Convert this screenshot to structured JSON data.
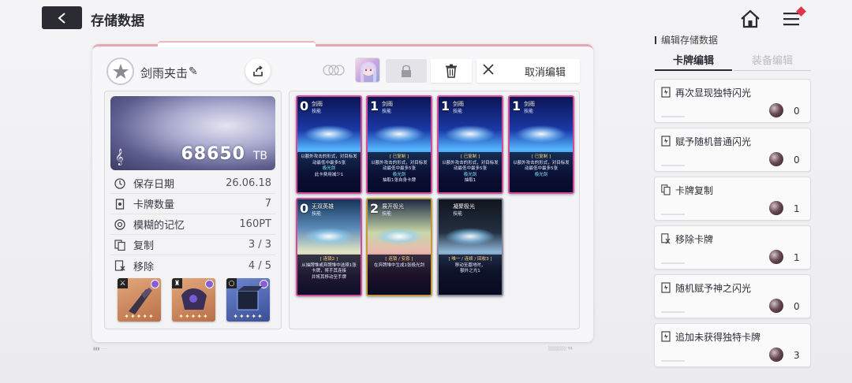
{
  "header": {
    "title": "存储数据",
    "back_icon": "back-arrow-icon",
    "home_icon": "home-icon",
    "menu_icon": "menu-icon"
  },
  "deck": {
    "name": "剑雨夹击",
    "cancel_edit_label": "取消编辑",
    "tb_value": "68650",
    "tb_unit": "TB"
  },
  "stats": [
    {
      "icon": "clock-icon",
      "label": "保存日期",
      "value": "26.06.18"
    },
    {
      "icon": "card-count-icon",
      "label": "卡牌数量",
      "value": "7"
    },
    {
      "icon": "memory-icon",
      "label": "模糊的记忆",
      "value": "160PT"
    },
    {
      "icon": "copy-icon",
      "label": "复制",
      "value": "3 / 3"
    },
    {
      "icon": "remove-icon",
      "label": "移除",
      "value": "4 / 5"
    }
  ],
  "equipment": [
    {
      "slot_icon": "weapon-slot-icon",
      "color": "#c9825a"
    },
    {
      "slot_icon": "armor-slot-icon",
      "color": "#c9825a"
    },
    {
      "slot_icon": "accessory-slot-icon",
      "color": "#4a62a8"
    }
  ],
  "cards": [
    {
      "cost": "0",
      "name": "剑雨",
      "type": "技能",
      "style": "blue",
      "tag": "",
      "text": "以额外攻击的形式，对目标发动最低中最多5张",
      "hl": "极光剑",
      "foot": "此卡费用减少1"
    },
    {
      "cost": "1",
      "name": "剑雨",
      "type": "技能",
      "style": "blue",
      "tag": "[ 已复制 ]",
      "text": "以额外攻击的形式，对目标发动最低中最多5张",
      "hl": "极光剑",
      "foot": "抽取1张自身卡牌"
    },
    {
      "cost": "1",
      "name": "剑雨",
      "type": "技能",
      "style": "blue",
      "tag": "[ 已复制 ]",
      "text": "以额外攻击的形式，对目标发动最低中最多5张",
      "hl": "极光剑",
      "foot": "抽取1"
    },
    {
      "cost": "1",
      "name": "剑雨",
      "type": "技能",
      "style": "blue",
      "tag": "[ 已复制 ]",
      "text": "以额外攻击的形式，对目标发动最低中最多5张",
      "hl": "极光剑",
      "foot": ""
    },
    {
      "cost": "0",
      "name": "无双英雄",
      "type": "技能",
      "style": "girl",
      "tag": "[ 连锁2 ]",
      "text": "从抽牌堆或弃牌堆中选择1张卡牌，将手其连接",
      "hl": "",
      "foot": "并将其移动至手牌"
    },
    {
      "cost": "2",
      "name": "展开极光",
      "type": "技能",
      "style": "girl2",
      "tag": "[ 连锁 / 安息 ]",
      "text": "在弃牌堆中生成1张极光剑",
      "hl": "",
      "foot": ""
    },
    {
      "cost": "",
      "name": "凝聚极光",
      "type": "技能",
      "style": "dark",
      "tag": "[ 唯一 / 连续 / 回收3 ]",
      "text": "移动至墓地时，",
      "hl": "",
      "foot": "额外之光1"
    }
  ],
  "side": {
    "title": "编辑存储数据",
    "tab_card": "卡牌编辑",
    "tab_equip": "装备编辑",
    "options": [
      {
        "icon": "flash-card-icon",
        "label": "再次显现独特闪光",
        "count": "0"
      },
      {
        "icon": "flash-card-icon",
        "label": "赋予随机普通闪光",
        "count": "0"
      },
      {
        "icon": "copy-card-icon",
        "label": "卡牌复制",
        "count": "1"
      },
      {
        "icon": "remove-card-icon",
        "label": "移除卡牌",
        "count": "1"
      },
      {
        "icon": "flash-card-icon",
        "label": "随机赋予神之闪光",
        "count": "0"
      },
      {
        "icon": "flash-card-icon",
        "label": "追加未获得独特卡牌",
        "count": "3"
      }
    ]
  }
}
